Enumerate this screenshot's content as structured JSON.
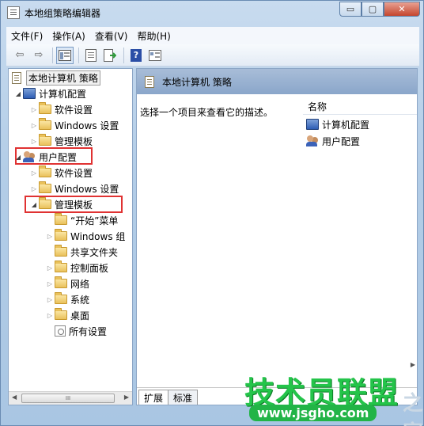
{
  "window": {
    "title": "本地组策略编辑器",
    "minimize": "▭",
    "maximize": "▢",
    "close": "✕"
  },
  "menu": [
    "文件(F)",
    "操作(A)",
    "查看(V)",
    "帮助(H)"
  ],
  "toolbar": {
    "back_icon": "⇦",
    "forward_icon": "⇨",
    "help_label": "?"
  },
  "tree": {
    "root": "本地计算机 策略",
    "computer_config": "计算机配置",
    "computer_children": [
      "软件设置",
      "Windows 设置",
      "管理模板"
    ],
    "user_config": "用户配置",
    "user_children": [
      "软件设置",
      "Windows 设置"
    ],
    "admin_templates": "管理模板",
    "admin_children": [
      "“开始”菜单",
      "Windows 组",
      "共享文件夹",
      "控制面板",
      "网络",
      "系统",
      "桌面",
      "所有设置"
    ]
  },
  "scroll": {
    "thumb_grip": "III"
  },
  "right_pane": {
    "header": "本地计算机 策略",
    "description": "选择一个项目来查看它的描述。",
    "column_name": "名称",
    "items": [
      "计算机配置",
      "用户配置"
    ]
  },
  "tabs": [
    "扩展",
    "标准"
  ],
  "watermark": {
    "text": "技术员联盟",
    "url": "www.jsgho.com",
    "extra": "之家"
  }
}
